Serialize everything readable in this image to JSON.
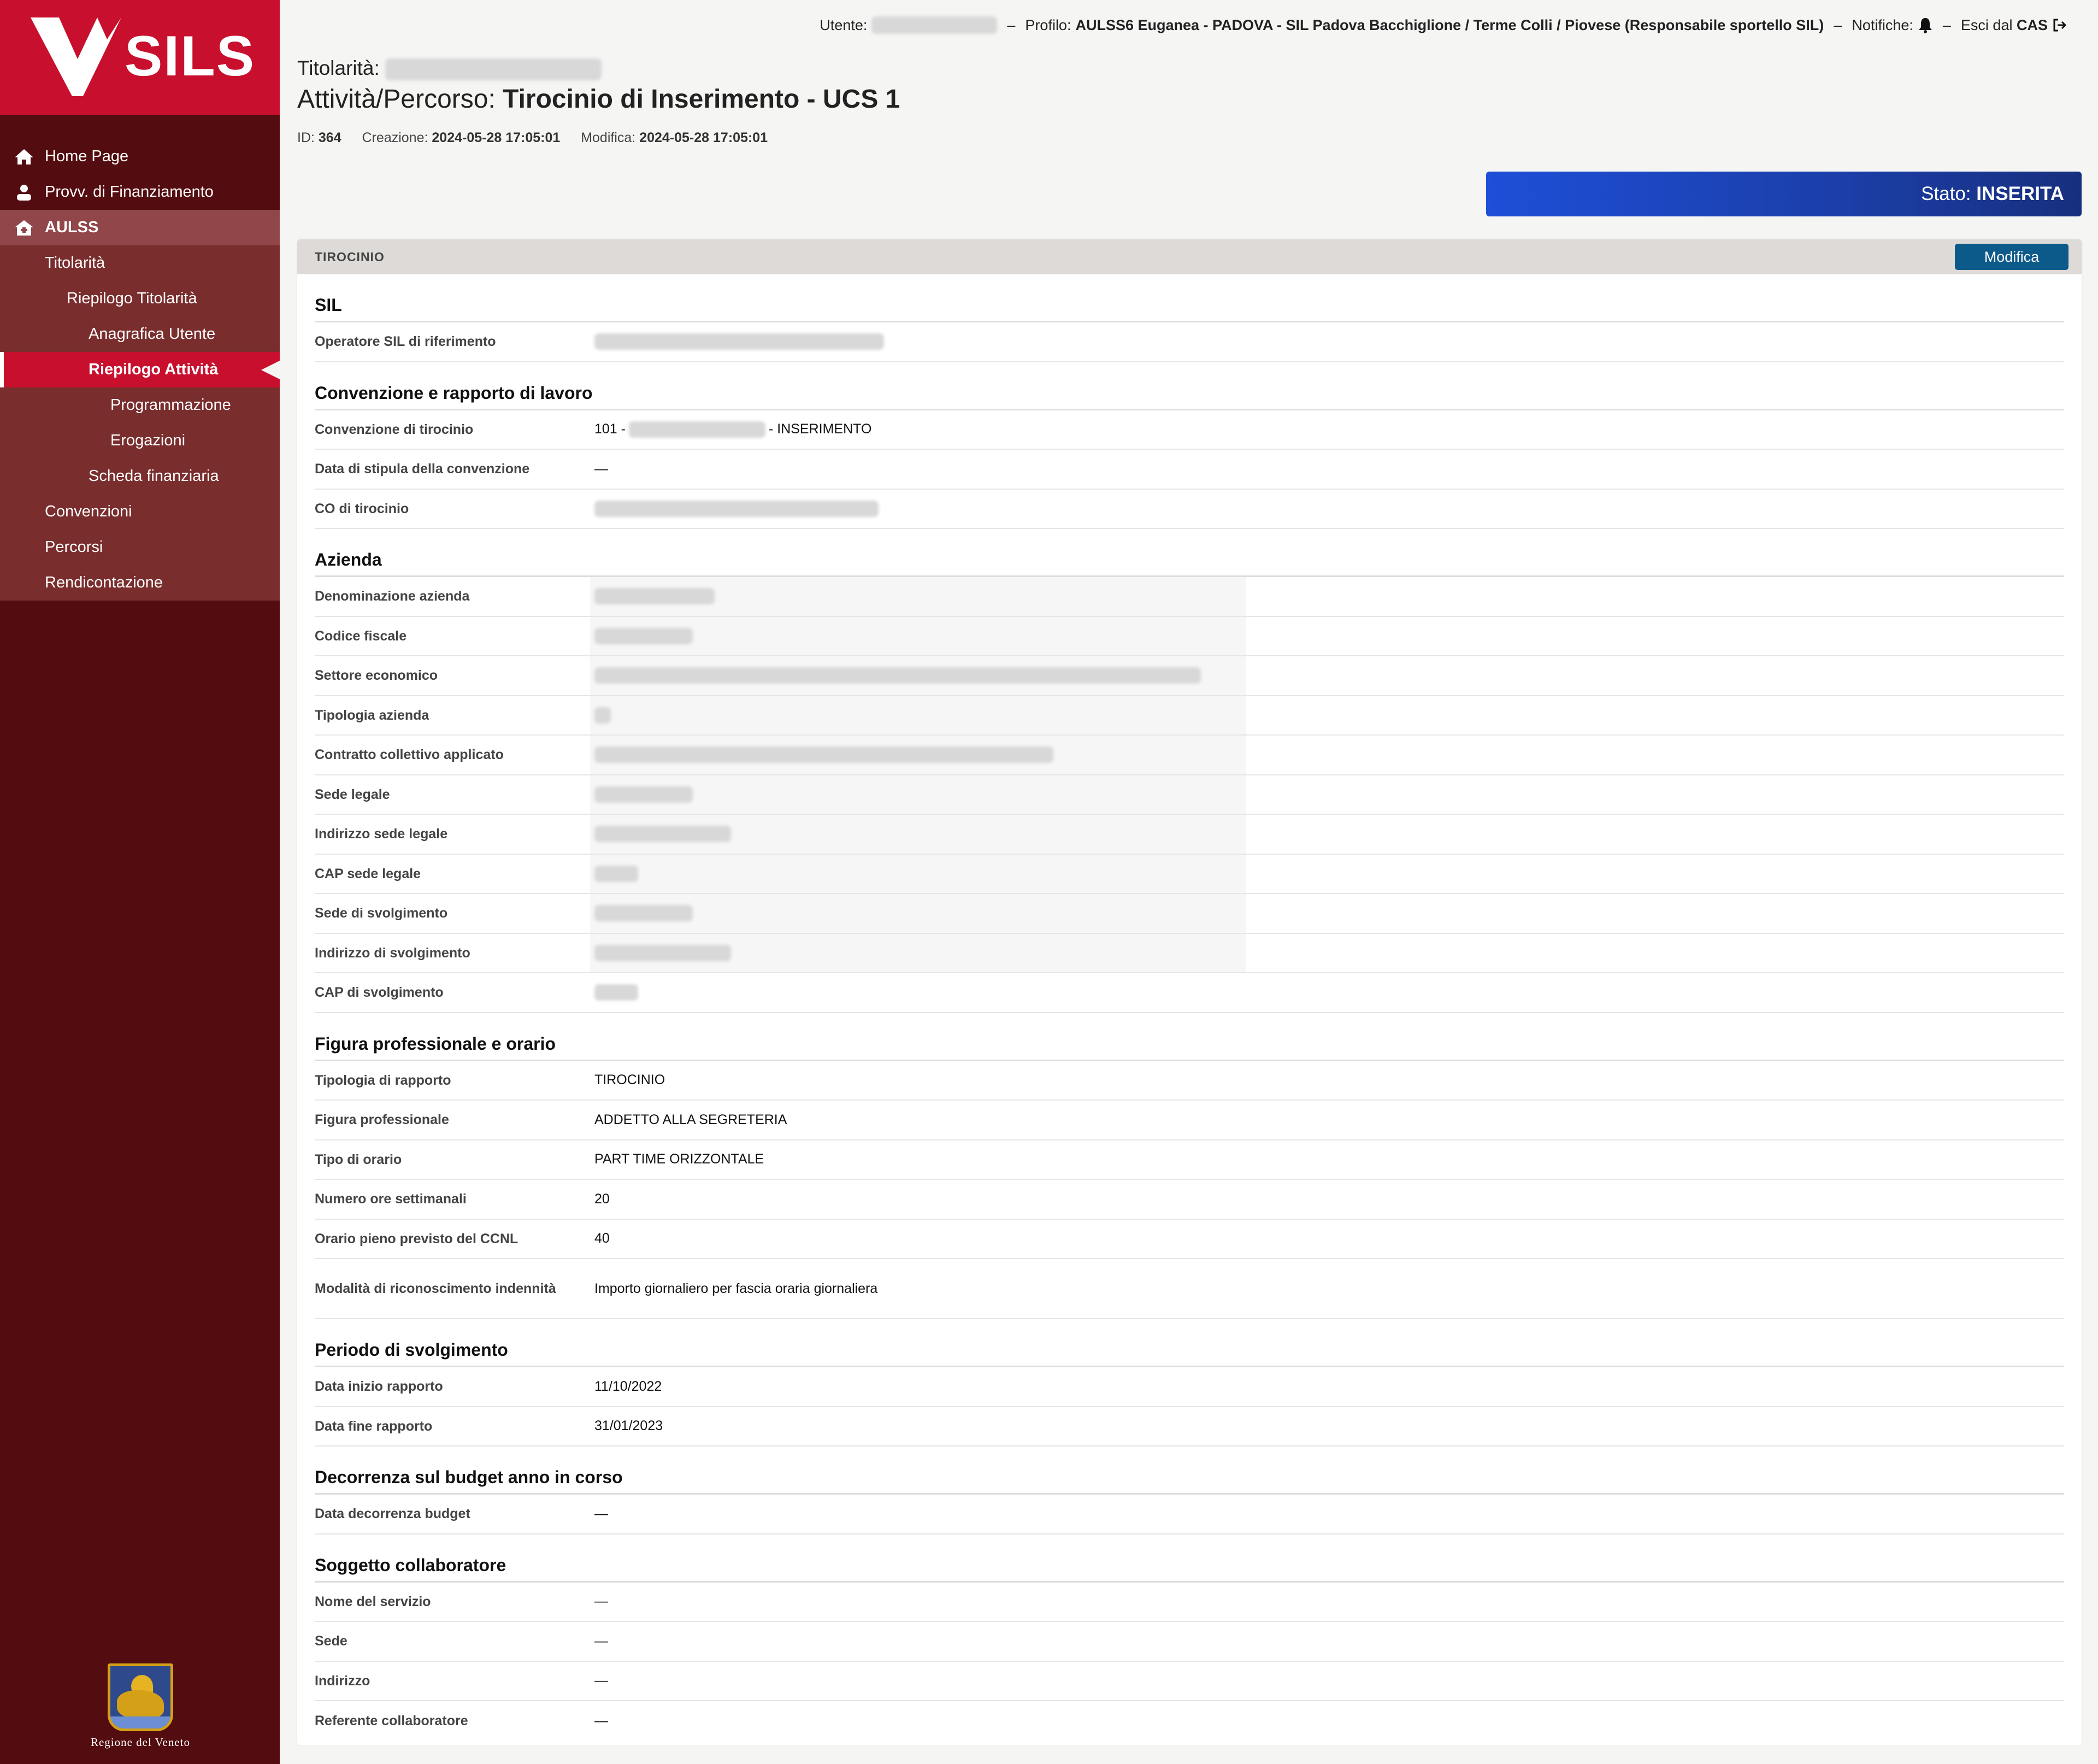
{
  "app": {
    "logo_text": "SILS",
    "region_name": "Regione del Veneto"
  },
  "topbar": {
    "user_label": "Utente:",
    "profile_label": "Profilo:",
    "profile_value": "AULSS6 Euganea - PADOVA - SIL Padova Bacchiglione / Terme Colli / Piovese (Responsabile sportello SIL)",
    "notifications_label": "Notifiche:",
    "logout_prefix": "Esci dal",
    "logout_target": "CAS",
    "separator": "–"
  },
  "sidebar": {
    "items": [
      {
        "label": "Home Page",
        "icon": "home-icon"
      },
      {
        "label": "Provv. di Finanziamento",
        "icon": "user-icon"
      },
      {
        "label": "AULSS",
        "icon": "building-icon"
      },
      {
        "label": "Titolarità"
      },
      {
        "label": "Riepilogo Titolarità"
      },
      {
        "label": "Anagrafica Utente"
      },
      {
        "label": "Riepilogo Attività"
      },
      {
        "label": "Programmazione"
      },
      {
        "label": "Erogazioni"
      },
      {
        "label": "Scheda finanziaria"
      },
      {
        "label": "Convenzioni"
      },
      {
        "label": "Percorsi"
      },
      {
        "label": "Rendicontazione"
      }
    ]
  },
  "header": {
    "titolarita_label": "Titolarità:",
    "title_prefix": "Attività/Percorso:",
    "title_value": "Tirocinio di Inserimento - UCS 1",
    "id_label": "ID:",
    "id_value": "364",
    "created_label": "Creazione:",
    "created_value": "2024-05-28 17:05:01",
    "modified_label": "Modifica:",
    "modified_value": "2024-05-28 17:05:01"
  },
  "status": {
    "label": "Stato:",
    "value": "INSERITA",
    "color": "#1e4fd8"
  },
  "card": {
    "header_label": "TIROCINIO",
    "edit_button": "Modifica",
    "sections": {
      "sil": {
        "title": "SIL",
        "rows": [
          {
            "label": "Operatore SIL di riferimento"
          }
        ]
      },
      "convenzione": {
        "title": "Convenzione e rapporto di lavoro",
        "rows": [
          {
            "label": "Convenzione di tirocinio",
            "prefix": "101 -",
            "suffix": "- INSERIMENTO"
          },
          {
            "label": "Data di stipula della convenzione",
            "value": "—"
          },
          {
            "label": "CO di tirocinio"
          }
        ]
      },
      "azienda": {
        "title": "Azienda",
        "rows": [
          {
            "label": "Denominazione azienda"
          },
          {
            "label": "Codice fiscale"
          },
          {
            "label": "Settore economico"
          },
          {
            "label": "Tipologia azienda"
          },
          {
            "label": "Contratto collettivo applicato"
          },
          {
            "label": "Sede legale"
          },
          {
            "label": "Indirizzo sede legale"
          },
          {
            "label": "CAP sede legale"
          },
          {
            "label": "Sede di svolgimento"
          },
          {
            "label": "Indirizzo di svolgimento"
          },
          {
            "label": "CAP di svolgimento"
          }
        ]
      },
      "figura": {
        "title": "Figura professionale e orario",
        "rows": [
          {
            "label": "Tipologia di rapporto",
            "value": "TIROCINIO"
          },
          {
            "label": "Figura professionale",
            "value": "ADDETTO ALLA SEGRETERIA"
          },
          {
            "label": "Tipo di orario",
            "value": "PART TIME ORIZZONTALE"
          },
          {
            "label": "Numero ore settimanali",
            "value": "20"
          },
          {
            "label": "Orario pieno previsto del CCNL",
            "value": "40"
          },
          {
            "label": "Modalità di riconoscimento indennità",
            "value": "Importo giornaliero per fascia oraria giornaliera"
          }
        ]
      },
      "periodo": {
        "title": "Periodo di svolgimento",
        "rows": [
          {
            "label": "Data inizio rapporto",
            "value": "11/10/2022"
          },
          {
            "label": "Data fine rapporto",
            "value": "31/01/2023"
          }
        ]
      },
      "budget": {
        "title": "Decorrenza sul budget anno in corso",
        "rows": [
          {
            "label": "Data decorrenza budget",
            "value": "—"
          }
        ]
      },
      "soggetto": {
        "title": "Soggetto collaboratore",
        "rows": [
          {
            "label": "Nome del servizio",
            "value": "—"
          },
          {
            "label": "Sede",
            "value": "—"
          },
          {
            "label": "Indirizzo",
            "value": "—"
          },
          {
            "label": "Referente collaboratore",
            "value": "—"
          }
        ]
      }
    }
  }
}
